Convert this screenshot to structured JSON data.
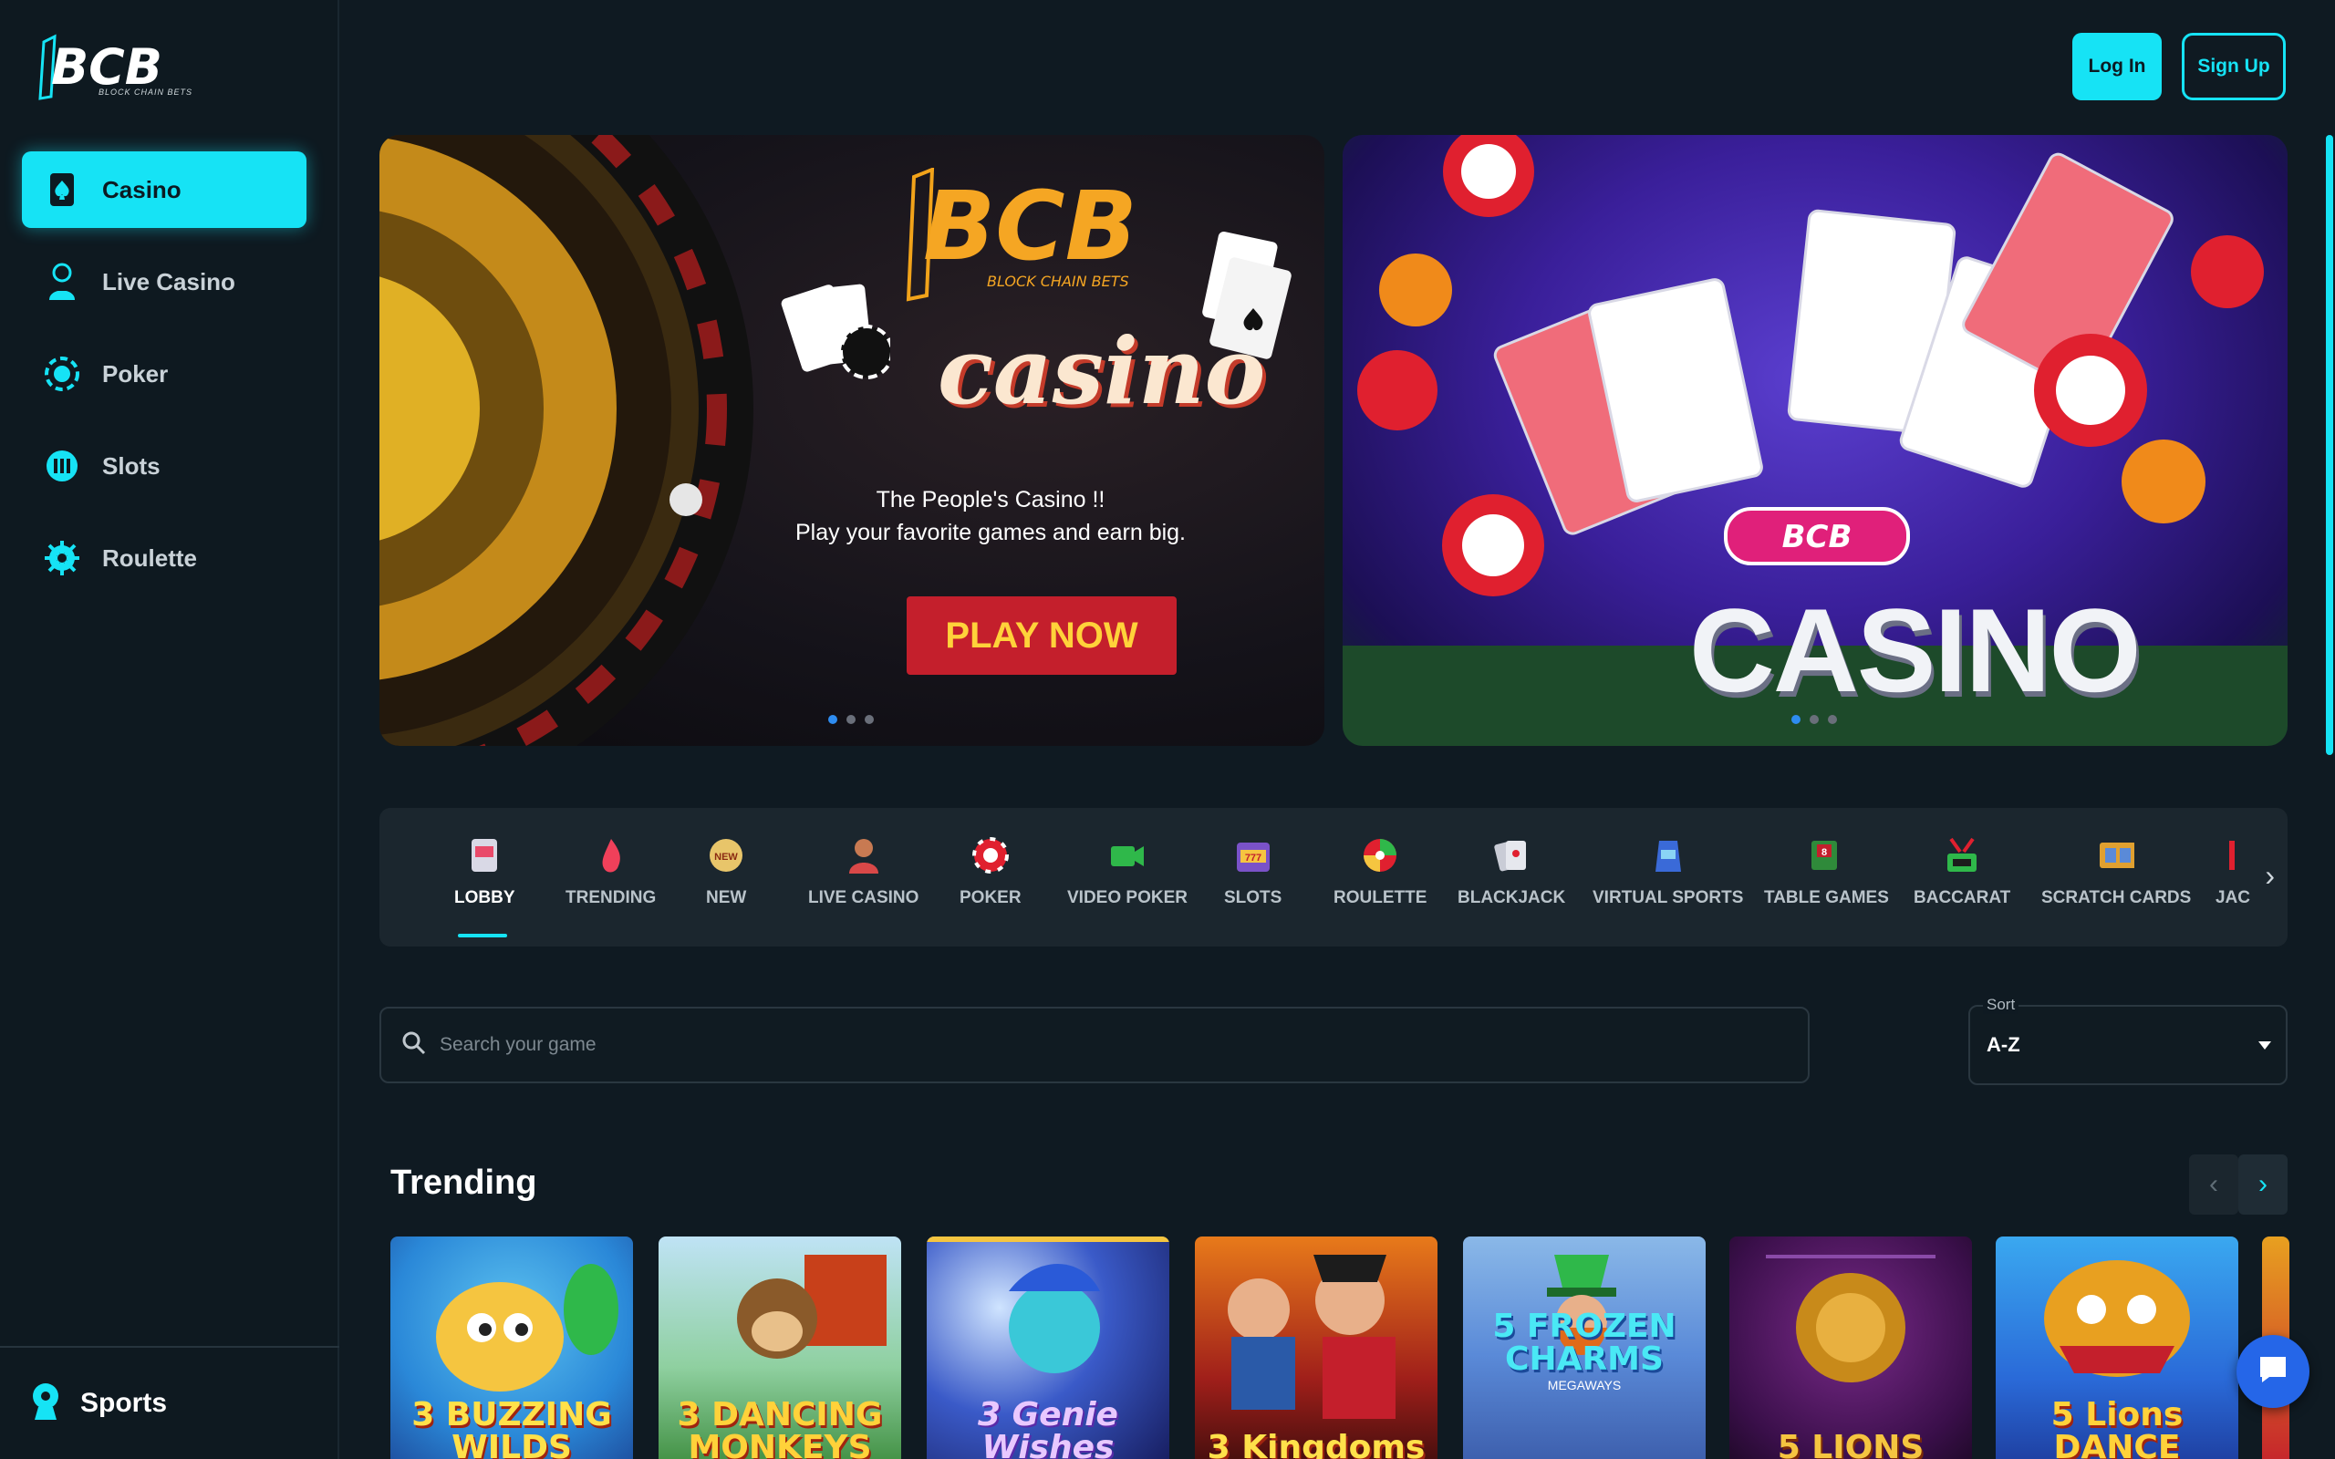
{
  "brand": {
    "logo_text": "BCB",
    "tagline": "BLOCK CHAIN BETS"
  },
  "sidebar": {
    "items": [
      {
        "label": "Casino",
        "icon": "spade-card-icon",
        "active": true
      },
      {
        "label": "Live Casino",
        "icon": "dealer-icon"
      },
      {
        "label": "Poker",
        "icon": "poker-chip-icon"
      },
      {
        "label": "Slots",
        "icon": "slot-machine-icon"
      },
      {
        "label": "Roulette",
        "icon": "roulette-wheel-icon"
      }
    ],
    "bottom_label": "Sports"
  },
  "header": {
    "login_label": "Log In",
    "signup_label": "Sign Up"
  },
  "banners": {
    "left": {
      "brand": "BCB",
      "brand_sub": "BLOCK CHAIN BETS",
      "script": "casino",
      "line1": "The People's Casino !!",
      "line2": "Play your favorite games and earn big.",
      "cta": "PLAY NOW"
    },
    "right": {
      "title": "CASINO",
      "badge": "BCB"
    }
  },
  "categories": [
    {
      "label": "LOBBY",
      "icon": "slot-machine-icon",
      "active": true
    },
    {
      "label": "TRENDING",
      "icon": "flame-icon"
    },
    {
      "label": "NEW",
      "icon": "new-badge-icon"
    },
    {
      "label": "LIVE CASINO",
      "icon": "dealer-icon"
    },
    {
      "label": "POKER",
      "icon": "poker-chip-icon"
    },
    {
      "label": "VIDEO POKER",
      "icon": "video-camera-icon"
    },
    {
      "label": "SLOTS",
      "icon": "slot-777-icon"
    },
    {
      "label": "ROULETTE",
      "icon": "roulette-wheel-icon"
    },
    {
      "label": "BLACKJACK",
      "icon": "cards-icon"
    },
    {
      "label": "VIRTUAL SPORTS",
      "icon": "gamepad-icon"
    },
    {
      "label": "TABLE GAMES",
      "icon": "table-game-icon"
    },
    {
      "label": "BACCARAT",
      "icon": "baccarat-icon"
    },
    {
      "label": "SCRATCH CARDS",
      "icon": "scratch-card-icon"
    },
    {
      "label": "JAC",
      "icon": "jackpot-icon"
    }
  ],
  "search": {
    "placeholder": "Search your game"
  },
  "sort": {
    "label": "Sort",
    "value": "A-Z"
  },
  "trending": {
    "title": "Trending",
    "games": [
      {
        "title": "3 BUZZING WILDS"
      },
      {
        "title": "3 DANCING MONKEYS"
      },
      {
        "title": "3 Genie Wishes"
      },
      {
        "title": "3 Kingdoms"
      },
      {
        "title": "5 FROZEN CHARMS",
        "sub": "MEGAWAYS"
      },
      {
        "title": "5 LIONS"
      },
      {
        "title": "5 Lions DANCE"
      }
    ]
  },
  "colors": {
    "accent": "#16e3f5",
    "bg": "#0f1a22",
    "sidebar": "#0e1920",
    "cta_red": "#c41f2c"
  }
}
